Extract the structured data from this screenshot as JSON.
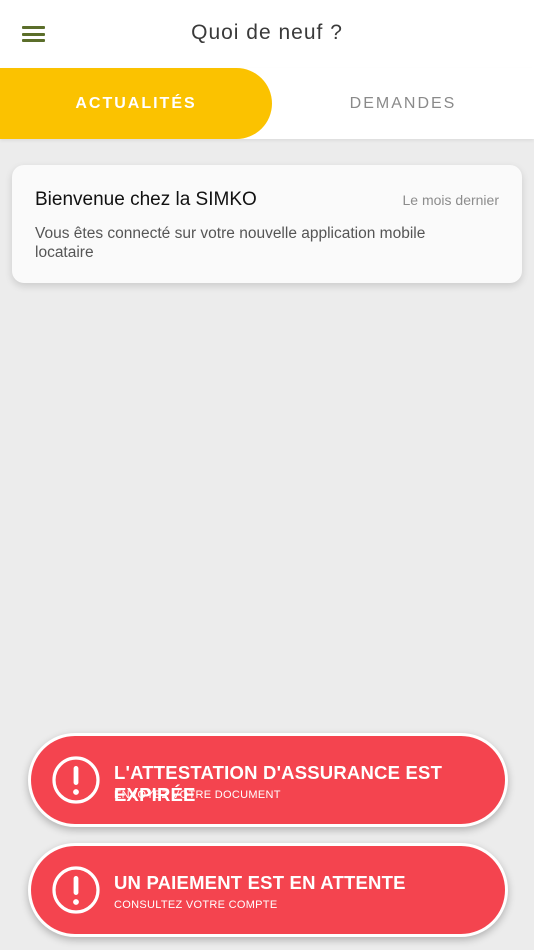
{
  "header": {
    "title": "Quoi de neuf ?",
    "menu_icon": "hamburger-menu-icon"
  },
  "tabs": [
    {
      "label": "ACTUALITÉS",
      "active": true
    },
    {
      "label": "DEMANDES",
      "active": false
    }
  ],
  "news": [
    {
      "title": "Bienvenue chez la SIMKO",
      "date": "Le mois dernier",
      "body": "Vous êtes connecté sur votre nouvelle application mobile locataire"
    }
  ],
  "alerts": [
    {
      "icon": "exclamation-circle-icon",
      "title": "L'ATTESTATION D'ASSURANCE EST EXPIRÉE",
      "subtitle": "ENVOYEZ VOTRE DOCUMENT"
    },
    {
      "icon": "exclamation-circle-icon",
      "title": "UN PAIEMENT EST EN ATTENTE",
      "subtitle": "CONSULTEZ VOTRE COMPTE"
    }
  ],
  "colors": {
    "accent_yellow": "#fbc200",
    "alert_red": "#f4444f",
    "menu_green": "#5b6e2a"
  }
}
